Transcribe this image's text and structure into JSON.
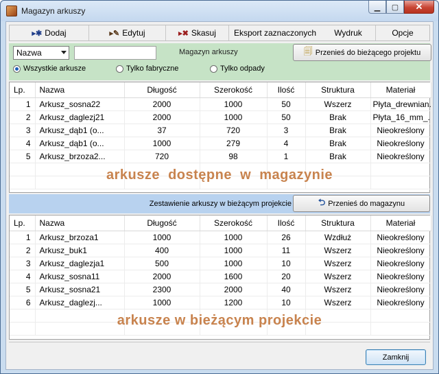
{
  "window": {
    "title": "Magazyn arkuszy"
  },
  "toolbar": {
    "add": "Dodaj",
    "edit": "Edytuj",
    "delete": "Skasuj",
    "export": "Eksport zaznaczonych",
    "print": "Wydruk",
    "options": "Opcje"
  },
  "filter": {
    "select_value": "Nazwa",
    "search_value": "",
    "panel_label": "Magazyn arkuszy",
    "transfer_button": "Przenieś do bieżącego projektu",
    "radio_all": "Wszystkie arkusze",
    "radio_factory": "Tylko fabryczne",
    "radio_waste": "Tylko odpady",
    "radio_selected": "all"
  },
  "columns": [
    "Lp.",
    "Nazwa",
    "Długość",
    "Szerokość",
    "Ilość",
    "Struktura",
    "Materiał"
  ],
  "warehouse": {
    "overlay": "arkusze  dostępne  w  magazynie",
    "rows": [
      [
        "1",
        "Arkusz_sosna22",
        "2000",
        "1000",
        "50",
        "Wszerz",
        "Płyta_drewnian..."
      ],
      [
        "2",
        "Arkusz_daglezj21",
        "2000",
        "1000",
        "50",
        "Brak",
        "Płyta_16_mm_..."
      ],
      [
        "3",
        "Arkusz_dąb1 (o...",
        "37",
        "720",
        "3",
        "Brak",
        "Nieokreślony"
      ],
      [
        "4",
        "Arkusz_dąb1 (o...",
        "1000",
        "279",
        "4",
        "Brak",
        "Nieokreślony"
      ],
      [
        "5",
        "Arkusz_brzoza2...",
        "720",
        "98",
        "1",
        "Brak",
        "Nieokreślony"
      ]
    ]
  },
  "info_band": {
    "label": "Zestawienie arkuszy w bieżącym projekcie",
    "transfer_button": "Przenieś do magazynu"
  },
  "project": {
    "overlay": "arkusze w bieżącym projekcie",
    "rows": [
      [
        "1",
        "Arkusz_brzoza1",
        "1000",
        "1000",
        "26",
        "Wzdłuż",
        "Nieokreślony"
      ],
      [
        "2",
        "Arkusz_buk1",
        "400",
        "1000",
        "11",
        "Wszerz",
        "Nieokreślony"
      ],
      [
        "3",
        "Arkusz_daglezja1",
        "500",
        "1000",
        "10",
        "Wszerz",
        "Nieokreślony"
      ],
      [
        "4",
        "Arkusz_sosna11",
        "2000",
        "1600",
        "20",
        "Wszerz",
        "Nieokreślony"
      ],
      [
        "5",
        "Arkusz_sosna21",
        "2300",
        "2000",
        "40",
        "Wszerz",
        "Nieokreślony"
      ],
      [
        "6",
        "Arkusz_daglezj...",
        "1000",
        "1200",
        "10",
        "Wszerz",
        "Nieokreślony"
      ]
    ]
  },
  "footer": {
    "close": "Zamknij"
  }
}
